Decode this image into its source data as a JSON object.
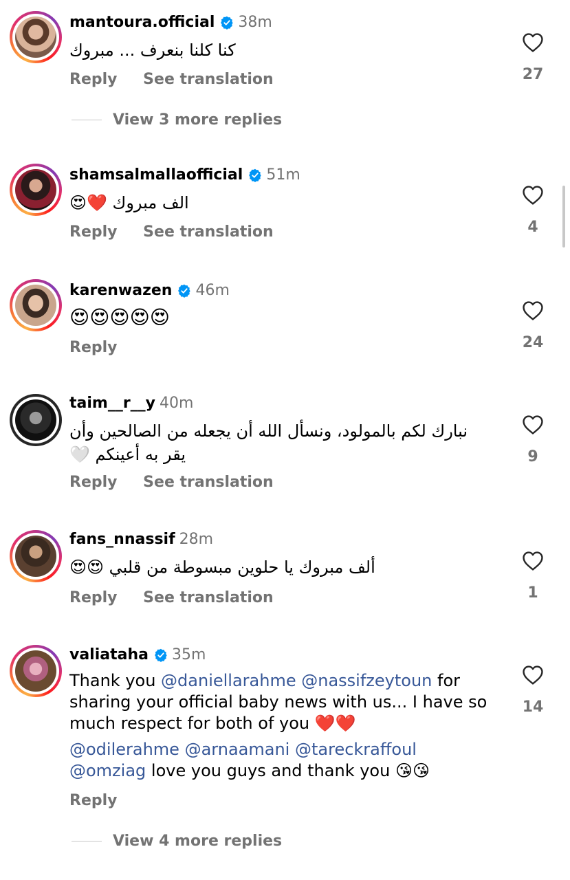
{
  "comments": [
    {
      "username": "mantoura.official",
      "verified": true,
      "time": "38m",
      "text": "كنا كلنا بنعرف ... مبروك",
      "reply": "Reply",
      "translate": "See translation",
      "likes": "27"
    },
    {
      "username": "shamsalmallaofficial",
      "verified": true,
      "time": "51m",
      "text": "الف مبروك ❤️😍",
      "reply": "Reply",
      "translate": "See translation",
      "likes": "4"
    },
    {
      "username": "karenwazen",
      "verified": true,
      "time": "46m",
      "text": "😍😍😍😍😍",
      "reply": "Reply",
      "likes": "24"
    },
    {
      "username": "taim__r__y",
      "verified": false,
      "time": "40m",
      "text_line1": "نبارك لكم بالمولود، ونسأل الله أن يجعله من الصالحين وأن",
      "text_line2": "يقر به أعينكم 🤍",
      "reply": "Reply",
      "translate": "See translation",
      "likes": "9"
    },
    {
      "username": "fans_nnassif",
      "verified": false,
      "time": "28m",
      "text": "ألف مبروك يا حلوين مبسوطة من قلبي 😍😍",
      "reply": "Reply",
      "translate": "See translation",
      "likes": "1"
    },
    {
      "username": "valiataha",
      "verified": true,
      "time": "35m",
      "text_a1": "Thank you ",
      "mention1": "@daniellarahme",
      "mention2": "@nassifzeytoun",
      "text_a2": " for",
      "text_a3": "sharing your official baby news with us... I have so",
      "text_a4": "much respect for both of you ❤️❤️",
      "mention3": "@odilerahme",
      "mention4": "@arnaamani",
      "mention5": "@tareckraffoul",
      "mention6": "@omziag",
      "text_b": " love you guys and thank you 😘😘",
      "reply": "Reply",
      "likes": "14"
    }
  ],
  "view_more_1": "View 3 more replies",
  "view_more_2": "View 4 more replies",
  "colors": {
    "verified": "#0095f6",
    "muted": "#737373",
    "mention": "#385898"
  }
}
